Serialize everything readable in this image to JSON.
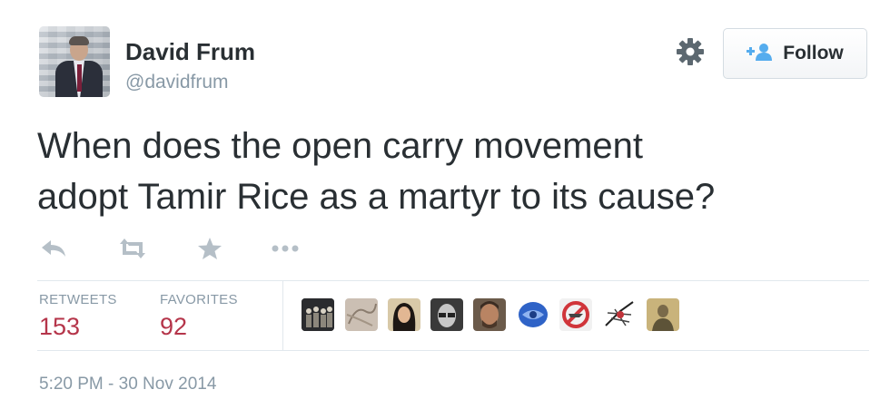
{
  "user": {
    "name": "David Frum",
    "handle": "@davidfrum"
  },
  "header": {
    "settings_icon": "gear-icon",
    "follow_label": "Follow",
    "follow_icon": "add-user-icon"
  },
  "tweet": {
    "line1": "When does the open carry movement",
    "line2": "adopt Tamir Rice as a martyr to its cause?"
  },
  "actions": [
    {
      "name": "reply",
      "icon": "reply-icon"
    },
    {
      "name": "retweet",
      "icon": "retweet-icon"
    },
    {
      "name": "favorite",
      "icon": "star-icon"
    },
    {
      "name": "more",
      "icon": "more-dots-icon"
    }
  ],
  "stats": {
    "retweets_label": "RETWEETS",
    "retweets_value": "153",
    "favorites_label": "FAVORITES",
    "favorites_value": "92"
  },
  "favoriters": [
    {
      "icon": "user-avatar-group-icon"
    },
    {
      "icon": "user-avatar-sketch-icon"
    },
    {
      "icon": "user-avatar-woman-icon"
    },
    {
      "icon": "user-avatar-glasses-icon"
    },
    {
      "icon": "user-avatar-man-icon"
    },
    {
      "icon": "user-avatar-blue-icon"
    },
    {
      "icon": "user-avatar-no-sign-icon"
    },
    {
      "icon": "user-avatar-bird-icon"
    },
    {
      "icon": "user-avatar-portrait-icon"
    }
  ],
  "timestamp": "5:20 PM - 30 Nov 2014",
  "colors": {
    "text": "#292f33",
    "muted": "#8899a6",
    "stat_value": "#b5354a",
    "follow_icon": "#55acee",
    "divider": "#e1e8ed"
  }
}
